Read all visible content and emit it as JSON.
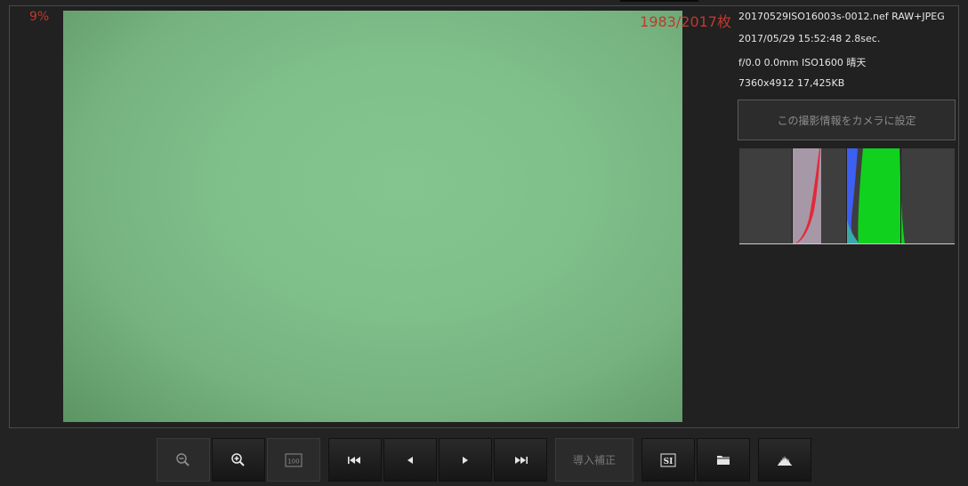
{
  "viewer": {
    "zoom_percent": "9%",
    "counter": "1983/2017枚"
  },
  "info": {
    "filename_line": "20170529ISO16003s-0012.nef RAW+JPEG",
    "datetime_line": "2017/05/29 15:52:48 2.8sec.",
    "exposure_line": "f/0.0 0.0mm ISO1600 晴天",
    "size_line": "7360x4912 17,425KB"
  },
  "set_camera_button": {
    "label": "この撮影情報をカメラに設定"
  },
  "toolbar": {
    "zoom_out_icon": "zoom-out-icon",
    "zoom_in_icon": "zoom-in-icon",
    "actual_size_icon": "100-percent-icon",
    "actual_size_label": "100",
    "first_icon": "skip-first-icon",
    "prev_icon": "prev-icon",
    "next_icon": "next-icon",
    "last_icon": "skip-last-icon",
    "correction_label": "導入補正",
    "si_label": "SI",
    "folder_icon": "folder-icon",
    "histogram_icon": "histogram-icon"
  },
  "colors": {
    "accent_red": "#c0392b",
    "photo_green": "#7fbf8a"
  }
}
